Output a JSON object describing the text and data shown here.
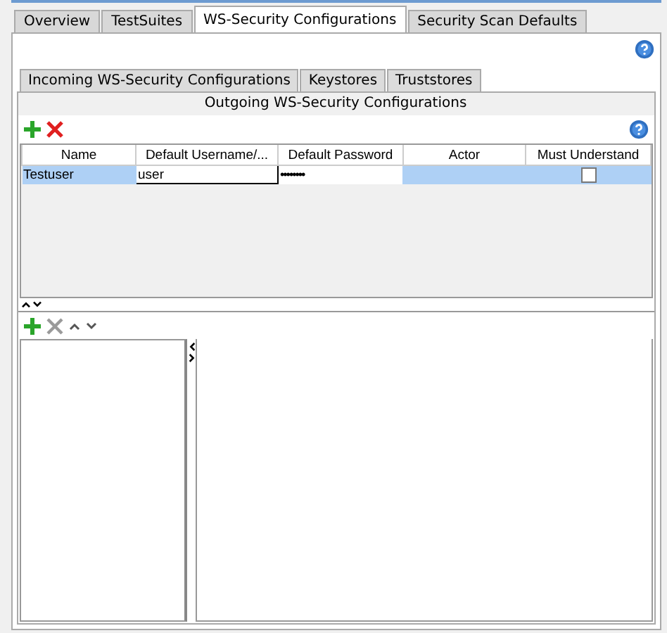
{
  "tabs": [
    {
      "label": "Overview",
      "selected": false
    },
    {
      "label": "TestSuites",
      "selected": false
    },
    {
      "label": "WS-Security Configurations",
      "selected": true
    },
    {
      "label": "Security Scan Defaults",
      "selected": false
    }
  ],
  "subtabs": [
    {
      "label": "Incoming WS-Security Configurations",
      "selected": false
    },
    {
      "label": "Keystores",
      "selected": false
    },
    {
      "label": "Truststores",
      "selected": false
    },
    {
      "label": "Outgoing WS-Security Configurations",
      "selected": true
    }
  ],
  "table": {
    "columns": [
      "Name",
      "Default Username/...",
      "Default Password",
      "Actor",
      "Must Understand"
    ],
    "rows": [
      {
        "selected": true,
        "name": "Testuser",
        "username": "user",
        "username_editing": true,
        "password": "••••••••",
        "actor": "",
        "must_understand": false
      }
    ]
  },
  "lower_toolbar": {
    "remove_disabled": true
  }
}
